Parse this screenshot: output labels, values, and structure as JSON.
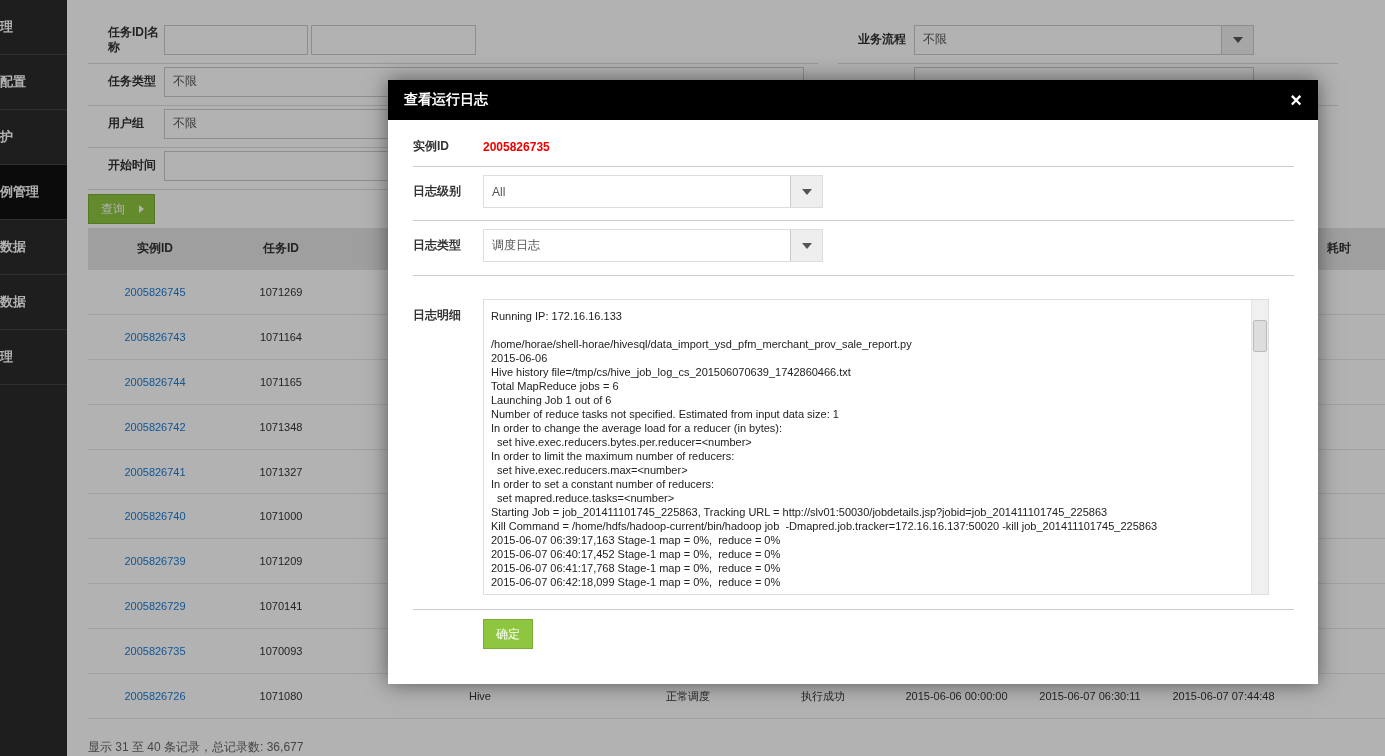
{
  "sidebar": {
    "items": [
      {
        "label": "理",
        "selected": false
      },
      {
        "label": "配置",
        "selected": false
      },
      {
        "label": "护",
        "selected": false
      },
      {
        "label": "例管理",
        "selected": true
      },
      {
        "label": "数据",
        "selected": false
      },
      {
        "label": "数据",
        "selected": false
      },
      {
        "label": "理",
        "selected": false
      }
    ]
  },
  "filters": {
    "task_id_name": {
      "label": "任务ID|名称"
    },
    "task_type": {
      "label": "任务类型",
      "value": "不限"
    },
    "user_group": {
      "label": "用户组",
      "value": "不限"
    },
    "start_time": {
      "label": "开始时间"
    },
    "business_flow": {
      "label": "业务流程",
      "value": "不限"
    },
    "query_button": "查询"
  },
  "table": {
    "columns": [
      "实例ID",
      "任务ID",
      "耗时"
    ],
    "rows": [
      {
        "cells": [
          "2005826745",
          "1071269"
        ]
      },
      {
        "cells": [
          "2005826743",
          "1071164"
        ]
      },
      {
        "cells": [
          "2005826744",
          "1071165"
        ]
      },
      {
        "cells": [
          "2005826742",
          "1071348"
        ]
      },
      {
        "cells": [
          "2005826741",
          "1071327"
        ]
      },
      {
        "cells": [
          "2005826740",
          "1071000"
        ]
      },
      {
        "cells": [
          "2005826739",
          "1071209"
        ]
      },
      {
        "cells": [
          "2005826729",
          "1070141"
        ]
      },
      {
        "cells": [
          "2005826735",
          "1070093"
        ]
      },
      {
        "cells": [
          "2005826726",
          "1071080",
          "Hive",
          "正常调度",
          "执行成功",
          "2015-06-06 00:00:00",
          "2015-06-07 06:30:11",
          "2015-06-07 07:44:48"
        ]
      }
    ]
  },
  "pagination": "显示 31 至 40 条记录，总记录数: 36,677",
  "dialog": {
    "title": "查看运行日志",
    "close": "×",
    "instance_id": {
      "label": "实例ID",
      "value": "2005826735"
    },
    "log_level": {
      "label": "日志级别",
      "value": "All"
    },
    "log_type": {
      "label": "日志类型",
      "value": "调度日志"
    },
    "log_detail": {
      "label": "日志明细",
      "paragraphs": [
        [
          "Running IP: 172.16.16.133"
        ],
        [
          "/home/horae/shell-horae/hivesql/data_import_ysd_pfm_merchant_prov_sale_report.py",
          "2015-06-06",
          "Hive history file=/tmp/cs/hive_job_log_cs_201506070639_1742860466.txt",
          "Total MapReduce jobs = 6",
          "Launching Job 1 out of 6",
          "Number of reduce tasks not specified. Estimated from input data size: 1",
          "In order to change the average load for a reducer (in bytes):",
          "  set hive.exec.reducers.bytes.per.reducer=<number>",
          "In order to limit the maximum number of reducers:",
          "  set hive.exec.reducers.max=<number>",
          "In order to set a constant number of reducers:",
          "  set mapred.reduce.tasks=<number>",
          "Starting Job = job_201411101745_225863, Tracking URL = http://slv01:50030/jobdetails.jsp?jobid=job_201411101745_225863",
          "Kill Command = /home/hdfs/hadoop-current/bin/hadoop job  -Dmapred.job.tracker=172.16.16.137:50020 -kill job_201411101745_225863",
          "2015-06-07 06:39:17,163 Stage-1 map = 0%,  reduce = 0%",
          "2015-06-07 06:40:17,452 Stage-1 map = 0%,  reduce = 0%",
          "2015-06-07 06:41:17,768 Stage-1 map = 0%,  reduce = 0%",
          "2015-06-07 06:42:18,099 Stage-1 map = 0%,  reduce = 0%"
        ]
      ]
    },
    "confirm_button": "确定"
  }
}
